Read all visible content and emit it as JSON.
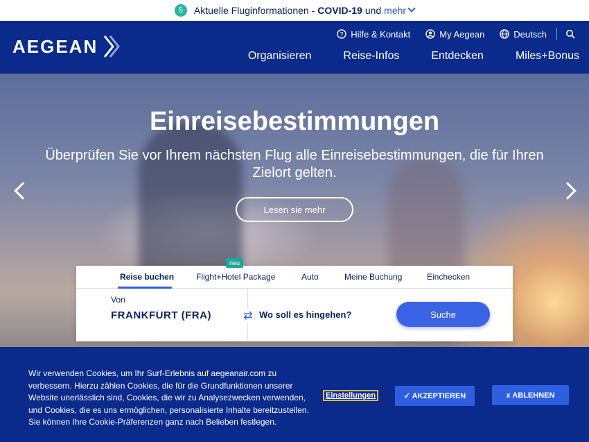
{
  "infobar": {
    "badge": "5",
    "text": "Aktuelle Fluginformationen -",
    "highlight": "COVID-19",
    "and": "und",
    "more": "mehr"
  },
  "header": {
    "logo": "AEGEAN",
    "util": {
      "help": "Hilfe & Kontakt",
      "account": "My Aegean",
      "language": "Deutsch"
    },
    "nav": [
      "Organisieren",
      "Reise-Infos",
      "Entdecken",
      "Miles+Bonus"
    ]
  },
  "hero": {
    "title": "Einreisebestimmungen",
    "subtitle": "Überprüfen Sie vor Ihrem nächsten Flug alle Einreisebestimmungen, die für Ihren Zielort gelten.",
    "button": "Lesen sie mehr"
  },
  "booking": {
    "tabs": [
      "Reise buchen",
      "Flight+Hotel Package",
      "Auto",
      "Meine Buchung",
      "Einchecken"
    ],
    "new_badge": "neu",
    "from_label": "Von",
    "from_value": "FRANKFURT (FRA)",
    "to_placeholder": "Wo soll es hingehen?",
    "search": "Suche"
  },
  "cookie": {
    "text": "Wir verwenden Cookies, um Ihr Surf-Erlebnis auf aegeanair.com zu verbessern. Hierzu zählen Cookies, die für die Grundfunktionen unserer Website unerlässlich sind, Cookies, die wir zu Analysezwecken verwenden, und Cookies, die es uns ermöglichen, personalisierte Inhalte bereitzustellen. Sie können Ihre Cookie-Präferenzen ganz nach Belieben festlegen.",
    "settings": "Einstellungen",
    "accept": "✓ AKZEPTIEREN",
    "reject": "x ABLEHNEN"
  },
  "colors": {
    "brand_blue": "#0a2a8c",
    "accent_blue": "#2d5fe0",
    "teal": "#1ea79a"
  }
}
